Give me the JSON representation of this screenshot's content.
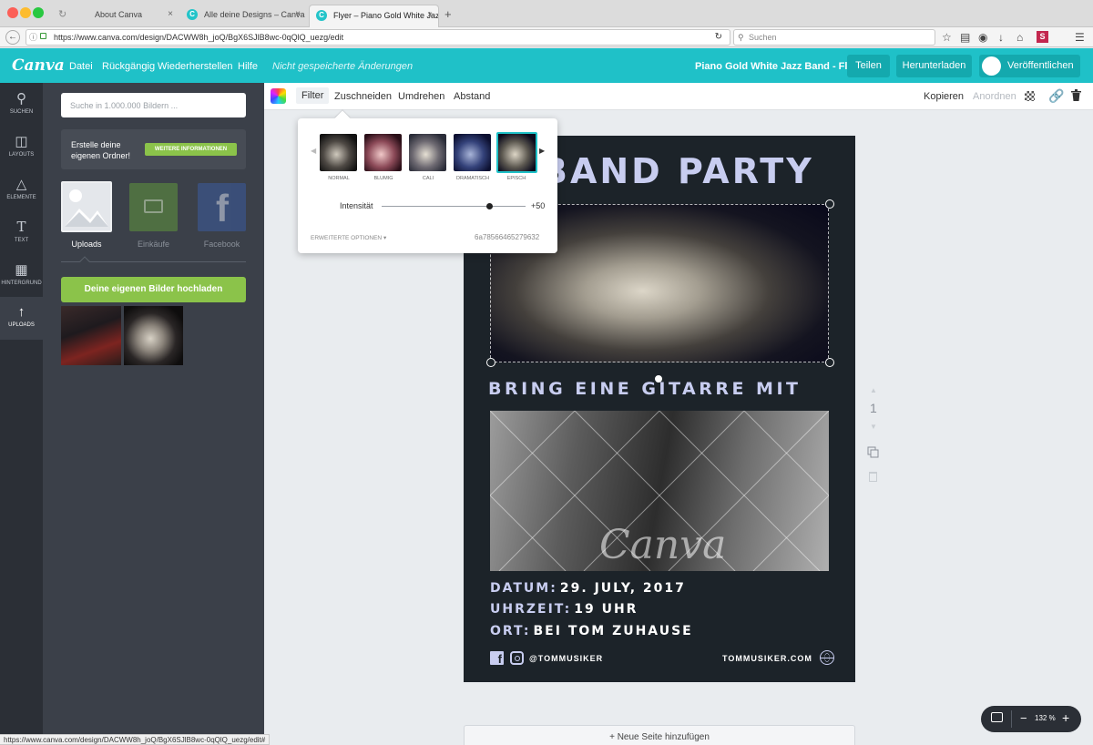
{
  "browser": {
    "tabs": [
      {
        "title": "About Canva"
      },
      {
        "title": "Alle deine Designs – Canva"
      },
      {
        "title": "Flyer – Piano Gold White Jazz"
      }
    ],
    "url": "https://www.canva.com/design/DACWW8h_joQ/BgX6SJlB8wc-0qQlQ_uezg/edit",
    "search_placeholder": "Suchen",
    "status_url": "https://www.canva.com/design/DACWW8h_joQ/BgX6SJlB8wc-0qQlQ_uezg/edit#"
  },
  "header": {
    "logo": "Canva",
    "menu": [
      "Datei",
      "Rückgängig",
      "Wiederherstellen",
      "Hilfe"
    ],
    "unsaved": "Nicht gespeicherte Änderungen",
    "doc_title": "Piano Gold White Jazz Band - Flyer",
    "share": "Teilen",
    "download": "Herunterladen",
    "publish": "Veröffentlichen",
    "brand_color": "#1fc1c8"
  },
  "rail": [
    {
      "label": "SUCHEN",
      "icon": "search-icon"
    },
    {
      "label": "LAYOUTS",
      "icon": "layouts-icon"
    },
    {
      "label": "ELEMENTE",
      "icon": "elements-icon"
    },
    {
      "label": "TEXT",
      "icon": "text-icon"
    },
    {
      "label": "HINTERGRUND",
      "icon": "background-icon"
    },
    {
      "label": "UPLOADS",
      "icon": "upload-icon"
    }
  ],
  "panel": {
    "search_placeholder": "Suche in 1.000.000 Bildern ...",
    "folder_text": "Erstelle deine eigenen Ordner!",
    "folder_button": "WEITERE INFORMATIONEN",
    "sources": [
      "Uploads",
      "Einkäufe",
      "Facebook"
    ],
    "upload_button": "Deine eigenen Bilder hochladen"
  },
  "toolbar": {
    "tools": [
      "Filter",
      "Zuschneiden",
      "Umdrehen",
      "Abstand"
    ],
    "copy": "Kopieren",
    "arrange": "Anordnen"
  },
  "filter": {
    "presets": [
      "NORMAL",
      "BLUMIG",
      "CALI",
      "DRAMATISCH",
      "EPISCH"
    ],
    "selected": "EPISCH",
    "intensity_label": "Intensität",
    "intensity_value": "+50",
    "intensity": 50,
    "advanced": "ERWEITERTE OPTIONEN",
    "filter_code": "6a78566465279632"
  },
  "flyer": {
    "headline": "BAND PARTY",
    "subheadline": "BRING EINE GITARRE MIT",
    "watermark": "Canva",
    "details": [
      {
        "label": "DATUM:",
        "value": "29. JULY, 2017"
      },
      {
        "label": "UHRZEIT:",
        "value": "19 UHR"
      },
      {
        "label": "ORT:",
        "value": "BEI TOM ZUHAUSE"
      }
    ],
    "social": "@TOMMUSIKER",
    "website": "TOMMUSIKER.COM"
  },
  "page_number": "1",
  "add_page": "+ Neue Seite hinzufügen",
  "zoom": "132 %"
}
